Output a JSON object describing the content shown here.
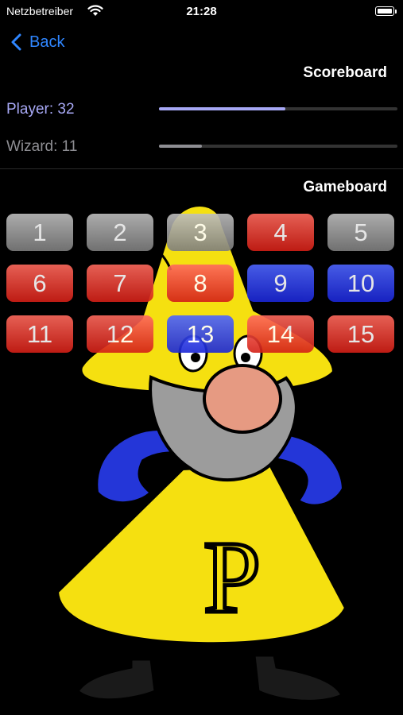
{
  "status_bar": {
    "carrier": "Netzbetreiber",
    "time": "21:28"
  },
  "nav": {
    "back_label": "Back"
  },
  "scoreboard": {
    "title": "Scoreboard",
    "player": {
      "label": "Player: 32",
      "value": 32,
      "progress": 0.53,
      "color": "#a7a8f5"
    },
    "wizard": {
      "label": "Wizard: 11",
      "value": 11,
      "progress": 0.18,
      "color": "#8e8e93"
    }
  },
  "gameboard": {
    "title": "Gameboard",
    "tiles": [
      {
        "label": "1",
        "color": "gray"
      },
      {
        "label": "2",
        "color": "gray"
      },
      {
        "label": "3",
        "color": "gray"
      },
      {
        "label": "4",
        "color": "red"
      },
      {
        "label": "5",
        "color": "gray"
      },
      {
        "label": "6",
        "color": "red"
      },
      {
        "label": "7",
        "color": "red"
      },
      {
        "label": "8",
        "color": "red"
      },
      {
        "label": "9",
        "color": "blue"
      },
      {
        "label": "10",
        "color": "blue"
      },
      {
        "label": "11",
        "color": "red"
      },
      {
        "label": "12",
        "color": "red"
      },
      {
        "label": "13",
        "color": "blue"
      },
      {
        "label": "14",
        "color": "red"
      },
      {
        "label": "15",
        "color": "red"
      }
    ]
  },
  "mascot": {
    "letter": "P"
  },
  "colors": {
    "accent": "#2f86ff",
    "red": "#e8352b",
    "blue": "#2a3cf0",
    "gray": "#9e9e9e",
    "yellow": "#f5e010"
  }
}
